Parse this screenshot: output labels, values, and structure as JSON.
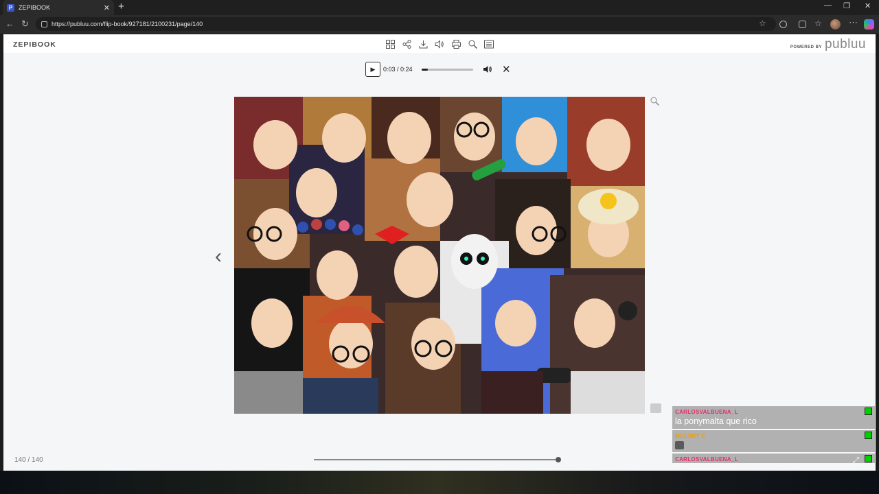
{
  "browser": {
    "tab_title": "ZEPIBOOK",
    "tab_favicon_letter": "P",
    "new_tab_glyph": "+",
    "url": "https://publuu.com/flip-book/927181/2100231/page/140",
    "window_controls": [
      "—",
      "❐",
      "✕"
    ]
  },
  "flipbook": {
    "brand": "ZEPIBOOK",
    "powered_by_label": "POWERED BY",
    "powered_by_logo": "publuu",
    "toolbar_icons": [
      "grid-icon",
      "share-icon",
      "download-icon",
      "sound-icon",
      "print-icon",
      "search-icon",
      "toc-icon"
    ],
    "audio": {
      "play_glyph": "▶",
      "time": "0:03 / 0:24",
      "progress": 0.125,
      "close_glyph": "✕"
    },
    "prev_glyph": "‹",
    "page_counter": "140 / 140",
    "page_slider_position": 1.0
  },
  "chat": {
    "messages": [
      {
        "user": "CARLOSVALBUENA_L",
        "user_color": "#e0306a",
        "text": "la ponymalta que rico"
      },
      {
        "user": "MELODY C",
        "user_color": "#e0a020",
        "text": ""
      },
      {
        "user": "CARLOSVALBUENA_L",
        "user_color": "#e0306a",
        "text": ""
      }
    ],
    "expand_glyph": "⤢"
  },
  "colors": {
    "accent_badge": "#00d000"
  }
}
